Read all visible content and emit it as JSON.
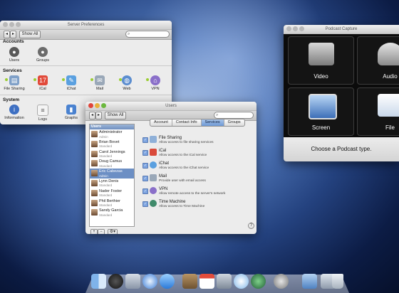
{
  "server_prefs": {
    "title": "Server Preferences",
    "show_all": "Show All",
    "sections": [
      {
        "label": "Accounts",
        "items": [
          {
            "label": "Users",
            "icon": "users-icon"
          },
          {
            "label": "Groups",
            "icon": "groups-icon"
          }
        ]
      },
      {
        "label": "Services",
        "items": [
          {
            "label": "File Sharing",
            "icon": "file-sharing-icon"
          },
          {
            "label": "iCal",
            "icon": "ical-icon"
          },
          {
            "label": "iChat",
            "icon": "ichat-icon"
          },
          {
            "label": "Mail",
            "icon": "mail-icon"
          },
          {
            "label": "Web",
            "icon": "web-icon"
          },
          {
            "label": "VPN",
            "icon": "vpn-icon"
          }
        ]
      },
      {
        "label": "System",
        "items": [
          {
            "label": "Information",
            "icon": "information-icon"
          },
          {
            "label": "Logs",
            "icon": "logs-icon"
          },
          {
            "label": "Graphs",
            "icon": "graphs-icon"
          }
        ]
      }
    ]
  },
  "users_window": {
    "title": "Users",
    "show_all": "Show All",
    "list_header": "Users",
    "users": [
      {
        "name": "Administrator",
        "role": "Admin"
      },
      {
        "name": "Brian Bovet",
        "role": "Standard"
      },
      {
        "name": "Carol Jennings",
        "role": "Standard"
      },
      {
        "name": "Doug Camus",
        "role": "Standard"
      },
      {
        "name": "Eric Cabezas",
        "role": "Admin",
        "selected": true
      },
      {
        "name": "Lynn Denis",
        "role": "Standard"
      },
      {
        "name": "Nader Foster",
        "role": "Standard"
      },
      {
        "name": "Phil Berthier",
        "role": "Standard"
      },
      {
        "name": "Sandy Garcia",
        "role": "Standard"
      }
    ],
    "add_symbol": "+",
    "remove_symbol": "−",
    "gear_symbol": "⚙▾",
    "help_symbol": "?",
    "tabs": [
      "Account",
      "Contact Info",
      "Services",
      "Groups"
    ],
    "active_tab": "Services",
    "services": [
      {
        "name": "File Sharing",
        "desc": "Allow access to file sharing services",
        "checked": true,
        "color": "#8fb0d8"
      },
      {
        "name": "iCal",
        "desc": "Allow access to the iCal service",
        "checked": true,
        "color": "#d94a3a"
      },
      {
        "name": "iChat",
        "desc": "Allow access to the iChat service",
        "checked": true,
        "color": "#5aa0e0"
      },
      {
        "name": "Mail",
        "desc": "Provide user with email access",
        "checked": true,
        "color": "#9aa8b8"
      },
      {
        "name": "VPN",
        "desc": "Allow remote access to the server's network",
        "checked": true,
        "color": "#8a6fc9"
      },
      {
        "name": "Time Machine",
        "desc": "Allow access to Time Machine",
        "checked": true,
        "color": "#3f8a6a"
      }
    ]
  },
  "podcast": {
    "title": "Podcast Capture",
    "tiles": [
      {
        "label": "Video",
        "icon": "video-camera-icon"
      },
      {
        "label": "Audio",
        "icon": "microphone-icon"
      },
      {
        "label": "Screen",
        "icon": "screen-icon"
      },
      {
        "label": "File",
        "icon": "file-icon"
      }
    ],
    "prompt": "Choose a Podcast type."
  },
  "dock": {
    "icons": [
      "finder-icon",
      "dashboard-icon",
      "mail-icon",
      "safari-icon",
      "ichat-icon",
      "address-book-icon",
      "ical-icon",
      "preview-icon",
      "itunes-icon",
      "time-machine-icon",
      "system-preferences-icon",
      "podcast-capture-icon",
      "stacks-icon",
      "trash-icon"
    ]
  }
}
